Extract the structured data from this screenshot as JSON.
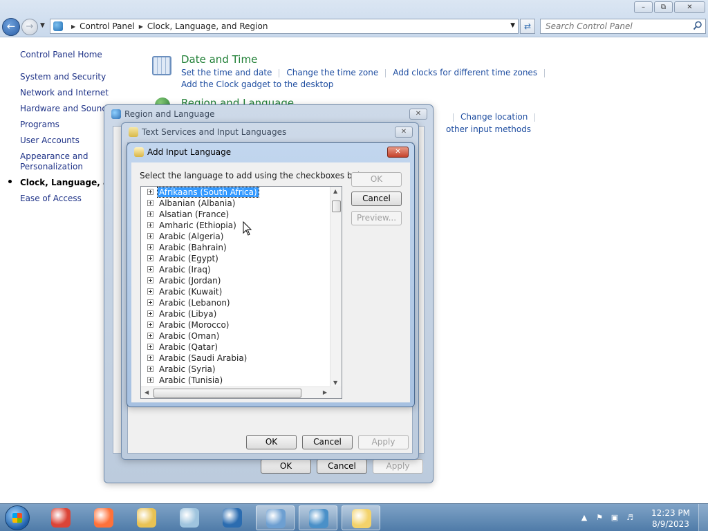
{
  "explorer": {
    "breadcrumb": [
      "Control Panel",
      "Clock, Language, and Region"
    ],
    "search_placeholder": "Search Control Panel",
    "window_buttons": {
      "minimize": "–",
      "maximize": "⧉",
      "close": "✕"
    }
  },
  "left_nav": {
    "home": "Control Panel Home",
    "items": [
      "System and Security",
      "Network and Internet",
      "Hardware and Sound",
      "Programs",
      "User Accounts",
      "Appearance and Personalization",
      "Clock, Language, and Region",
      "Ease of Access"
    ],
    "current_index": 6
  },
  "content": {
    "date_time": {
      "title": "Date and Time",
      "links": [
        "Set the time and date",
        "Change the time zone",
        "Add clocks for different time zones",
        "Add the Clock gadget to the desktop"
      ]
    },
    "region_language": {
      "title": "Region and Language",
      "links": [
        "Change location",
        "other input methods"
      ]
    }
  },
  "dialogs": {
    "region": {
      "title": "Region and Language",
      "ok": "OK",
      "cancel": "Cancel",
      "apply": "Apply"
    },
    "text_services": {
      "title": "Text Services and Input Languages",
      "ok": "OK",
      "cancel": "Cancel",
      "apply": "Apply"
    },
    "add_input": {
      "title": "Add Input Language",
      "instruction": "Select the language to add using the checkboxes below.",
      "ok": "OK",
      "cancel": "Cancel",
      "preview": "Preview...",
      "languages": [
        "Afrikaans (South Africa)",
        "Albanian (Albania)",
        "Alsatian (France)",
        "Amharic (Ethiopia)",
        "Arabic (Algeria)",
        "Arabic (Bahrain)",
        "Arabic (Egypt)",
        "Arabic (Iraq)",
        "Arabic (Jordan)",
        "Arabic (Kuwait)",
        "Arabic (Lebanon)",
        "Arabic (Libya)",
        "Arabic (Morocco)",
        "Arabic (Oman)",
        "Arabic (Qatar)",
        "Arabic (Saudi Arabia)",
        "Arabic (Syria)",
        "Arabic (Tunisia)"
      ],
      "selected_index": 0
    }
  },
  "taskbar": {
    "apps": [
      {
        "name": "chrome",
        "color": "#db4437",
        "active": false
      },
      {
        "name": "firefox",
        "color": "#ff7139",
        "active": false
      },
      {
        "name": "file-explorer",
        "color": "#e8c254",
        "active": false
      },
      {
        "name": "notepad",
        "color": "#9fc4de",
        "active": false
      },
      {
        "name": "app-s",
        "color": "#2b6cb0",
        "active": false
      },
      {
        "name": "control-panel",
        "color": "#6d9fd1",
        "active": true
      },
      {
        "name": "region-globe",
        "color": "#4a90c8",
        "active": true
      },
      {
        "name": "text-services",
        "color": "#f3d26a",
        "active": true
      }
    ],
    "clock_time": "12:23 PM",
    "clock_date": "8/9/2023"
  }
}
